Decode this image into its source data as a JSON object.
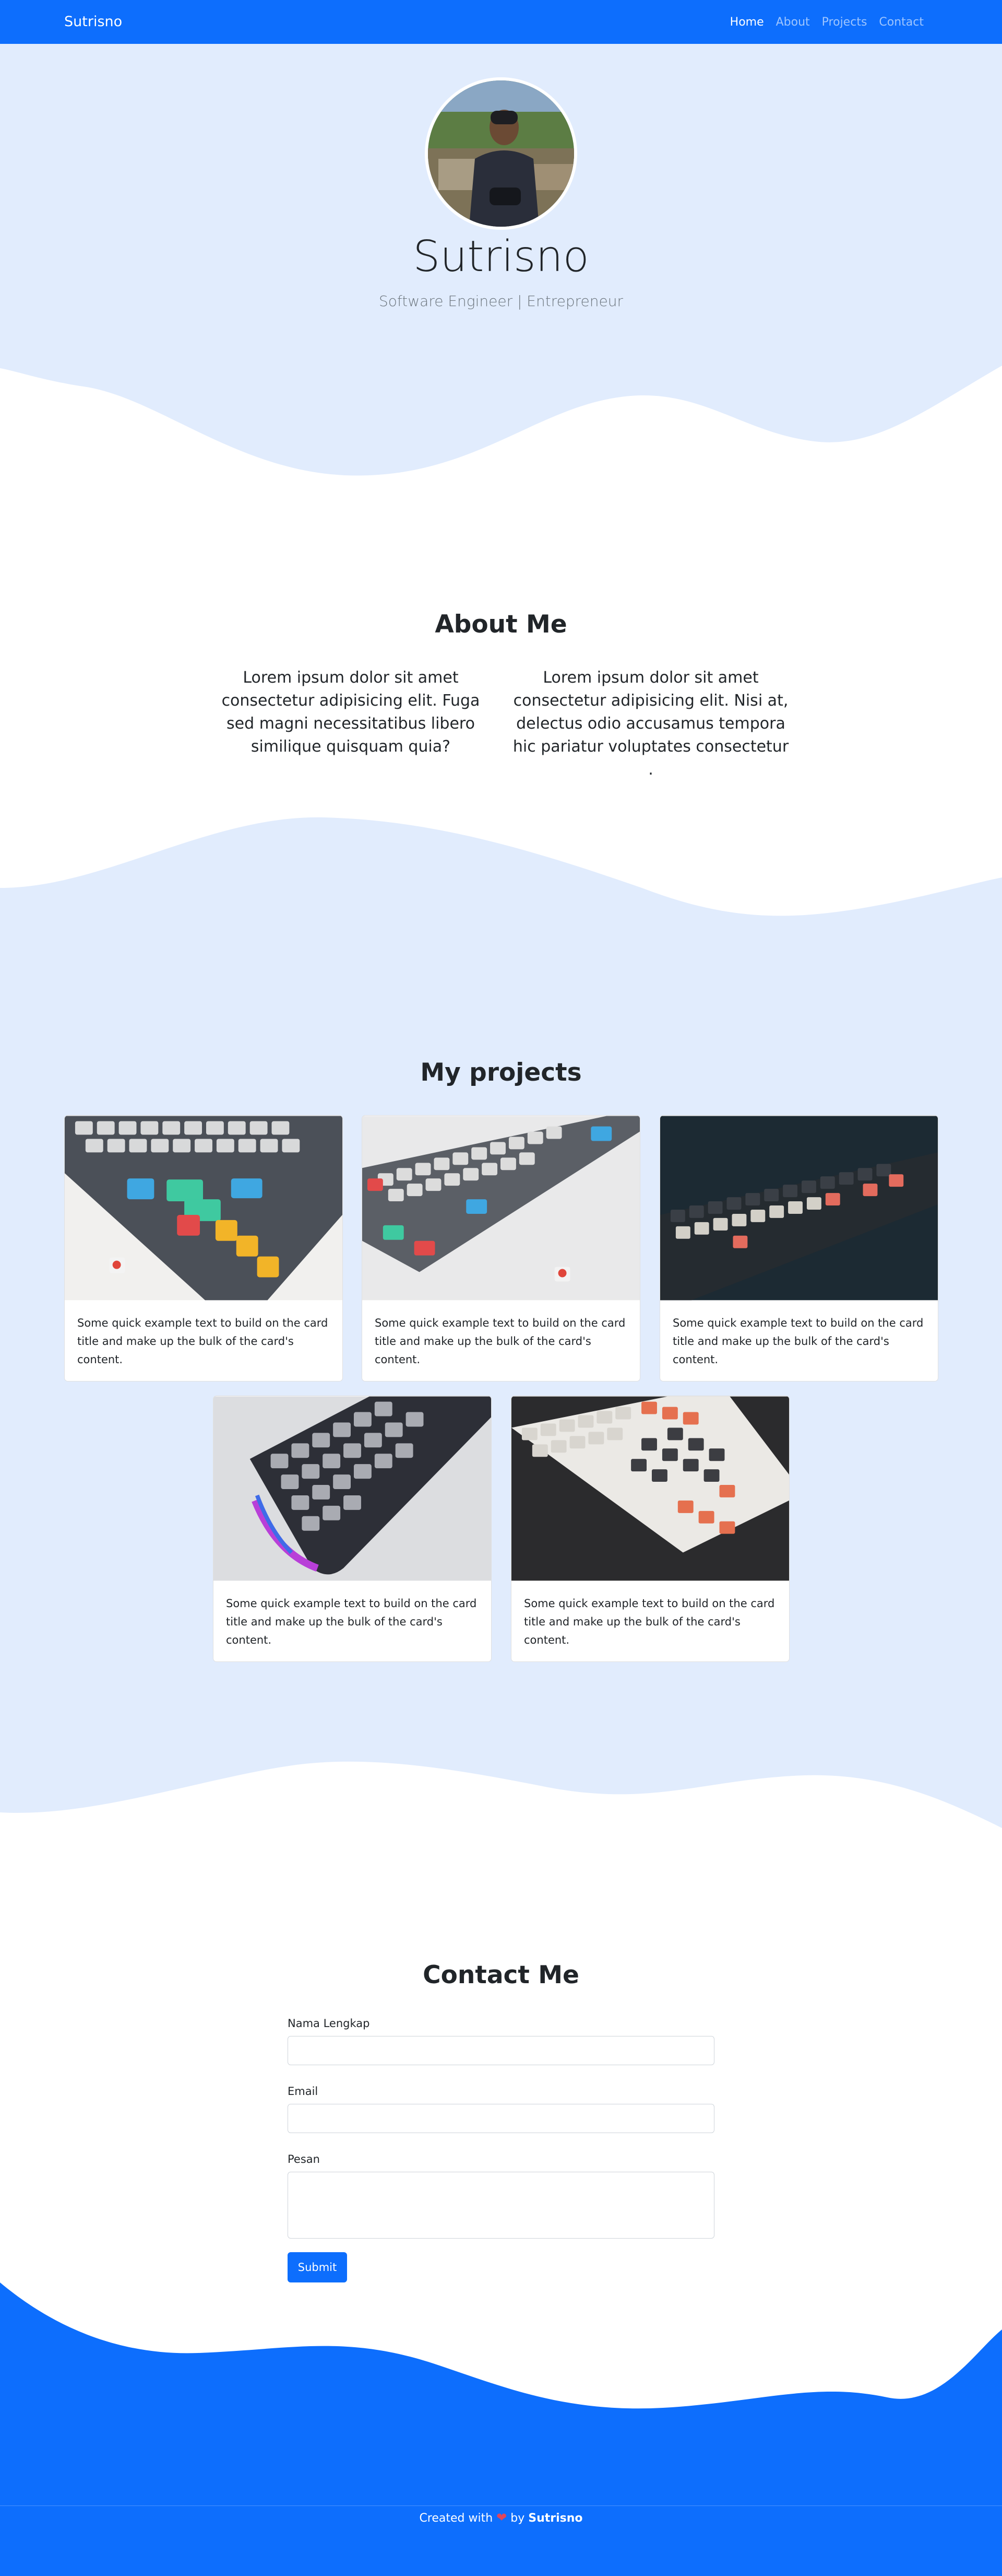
{
  "colors": {
    "primary": "#0d6efd",
    "light_blue": "#e1ecfd",
    "white": "#ffffff"
  },
  "navbar": {
    "brand": "Sutrisno",
    "links": [
      {
        "label": "Home",
        "active": true
      },
      {
        "label": "About",
        "active": false
      },
      {
        "label": "Projects",
        "active": false
      },
      {
        "label": "Contact",
        "active": false
      }
    ]
  },
  "hero": {
    "name": "Sutrisno",
    "subtitle": "Software Engineer | Entrepreneur"
  },
  "about": {
    "title": "About Me",
    "col1": "Lorem ipsum dolor sit amet consectetur adipisicing elit. Fuga sed magni necessitatibus libero similique quisquam quia?",
    "col2": "Lorem ipsum dolor sit amet consectetur adipisicing elit. Nisi at, delectus odio accusamus tempora hic pariatur voluptates consectetur ."
  },
  "projects": {
    "title": "My projects",
    "cards": [
      {
        "text": "Some quick example text to build on the card title and make up the bulk of the card's content."
      },
      {
        "text": "Some quick example text to build on the card title and make up the bulk of the card's content."
      },
      {
        "text": "Some quick example text to build on the card title and make up the bulk of the card's content."
      },
      {
        "text": "Some quick example text to build on the card title and make up the bulk of the card's content."
      },
      {
        "text": "Some quick example text to build on the card title and make up the bulk of the card's content."
      }
    ]
  },
  "contact": {
    "title": "Contact Me",
    "name_label": "Nama Lengkap",
    "email_label": "Email",
    "message_label": "Pesan",
    "name_value": "",
    "email_value": "",
    "message_value": "",
    "submit_label": "Submit"
  },
  "footer": {
    "prefix": "Created with",
    "heart": "❤",
    "by": "by",
    "author": "Sutrisno"
  }
}
